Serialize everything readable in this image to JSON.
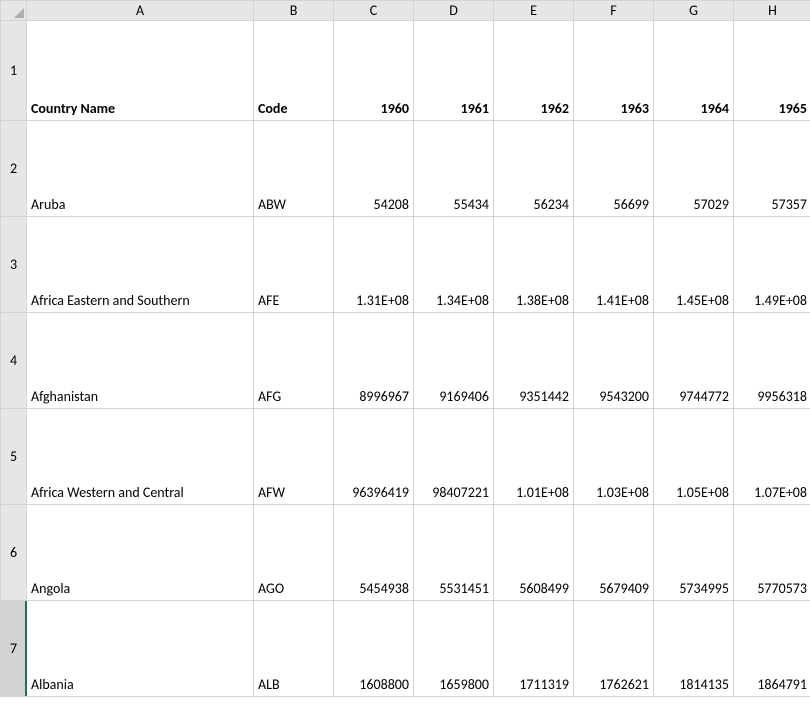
{
  "cols": [
    "A",
    "B",
    "C",
    "D",
    "E",
    "F",
    "G",
    "H"
  ],
  "rows": [
    "1",
    "2",
    "3",
    "4",
    "5",
    "6",
    "7"
  ],
  "active_row": "7",
  "grid": {
    "r1": {
      "A": "Country Name",
      "B": "Code",
      "C": "1960",
      "D": "1961",
      "E": "1962",
      "F": "1963",
      "G": "1964",
      "H": "1965"
    },
    "r2": {
      "A": "Aruba",
      "B": "ABW",
      "C": "54208",
      "D": "55434",
      "E": "56234",
      "F": "56699",
      "G": "57029",
      "H": "57357"
    },
    "r3": {
      "A": "Africa Eastern and Southern",
      "B": "AFE",
      "C": "1.31E+08",
      "D": "1.34E+08",
      "E": "1.38E+08",
      "F": "1.41E+08",
      "G": "1.45E+08",
      "H": "1.49E+08"
    },
    "r4": {
      "A": "Afghanistan",
      "B": "AFG",
      "C": "8996967",
      "D": "9169406",
      "E": "9351442",
      "F": "9543200",
      "G": "9744772",
      "H": "9956318"
    },
    "r5": {
      "A": "Africa Western and Central",
      "B": "AFW",
      "C": "96396419",
      "D": "98407221",
      "E": "1.01E+08",
      "F": "1.03E+08",
      "G": "1.05E+08",
      "H": "1.07E+08"
    },
    "r6": {
      "A": "Angola",
      "B": "AGO",
      "C": "5454938",
      "D": "5531451",
      "E": "5608499",
      "F": "5679409",
      "G": "5734995",
      "H": "5770573"
    },
    "r7": {
      "A": "Albania",
      "B": "ALB",
      "C": "1608800",
      "D": "1659800",
      "E": "1711319",
      "F": "1762621",
      "G": "1814135",
      "H": "1864791"
    }
  }
}
